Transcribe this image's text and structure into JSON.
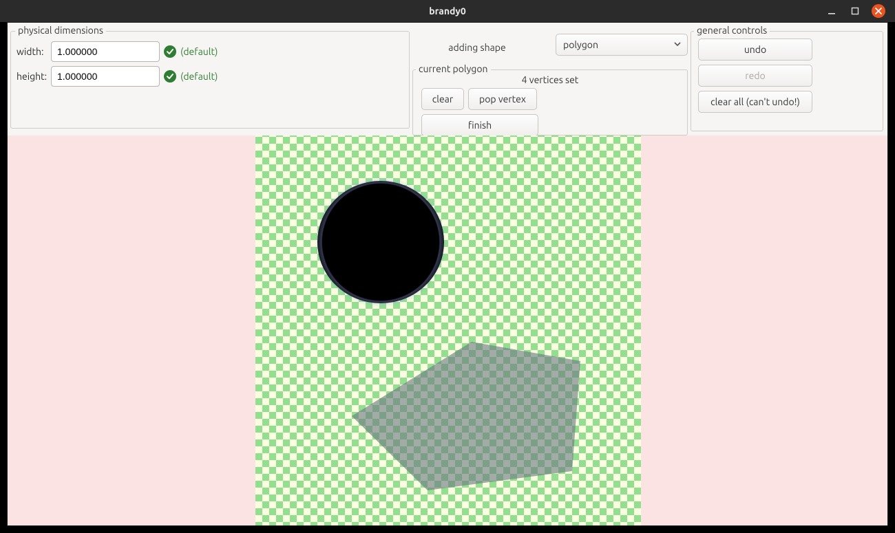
{
  "window": {
    "title": "brandy0"
  },
  "phys": {
    "legend": "physical dimensions",
    "width_label": "width:",
    "width_value": "1.000000",
    "width_hint": "(default)",
    "height_label": "height:",
    "height_value": "1.000000",
    "height_hint": "(default)"
  },
  "addshape": {
    "legend": "adding shape",
    "dropdown_value": "polygon"
  },
  "curpoly": {
    "legend": "current polygon",
    "vertices_text": "4 vertices set",
    "clear": "clear",
    "pop": "pop vertex",
    "finish": "finish"
  },
  "general": {
    "legend": "general controls",
    "undo": "undo",
    "redo": "redo",
    "clear_all": "clear all (can't undo!)",
    "redo_enabled": false
  }
}
